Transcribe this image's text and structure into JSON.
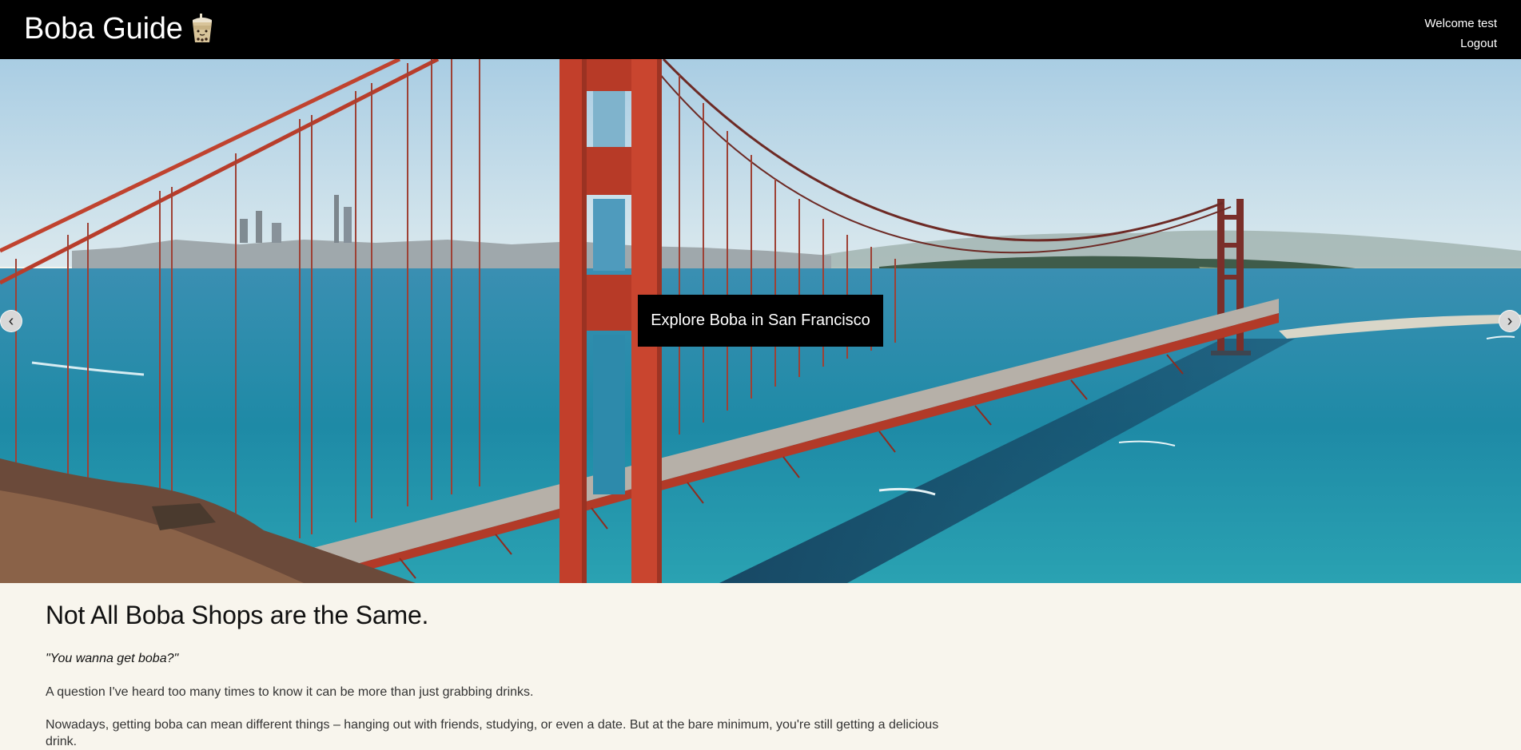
{
  "header": {
    "brand": "Boba Guide",
    "brand_icon": "boba-cup-icon",
    "welcome": "Welcome test",
    "logout": "Logout"
  },
  "carousel": {
    "caption": "Explore Boba in San Francisco",
    "prev_icon": "chevron-left-icon",
    "next_icon": "chevron-right-icon",
    "prev_glyph": "‹",
    "next_glyph": "›"
  },
  "main": {
    "heading": "Not All Boba Shops are the Same.",
    "quote": "\"You wanna get boba?\"",
    "paragraph1": "A question I've heard too many times to know it can be more than just grabbing drinks.",
    "paragraph2": "Nowadays, getting boba can mean different things – hanging out with friends, studying, or even a date. But at the bare minimum, you're still getting a delicious drink."
  },
  "colors": {
    "topbar": "#000000",
    "page_background": "#f8f5ed",
    "bridge_red": "#c8402b",
    "water": "#2a8fb0",
    "sky": "#b9d8e8"
  }
}
